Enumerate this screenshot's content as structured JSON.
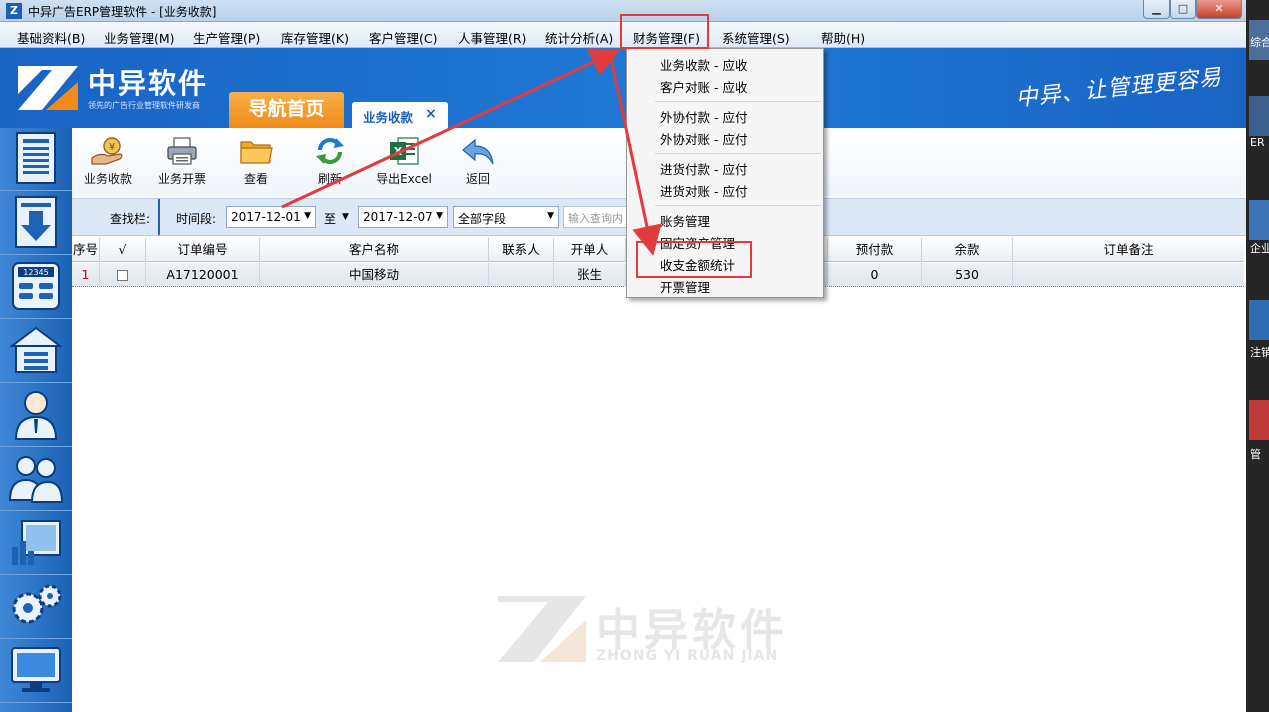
{
  "window": {
    "app_icon": "Z",
    "title": "中异广告ERP管理软件 - [业务收款]",
    "minimize_icon": "minimize-icon",
    "maximize_icon": "maximize-icon",
    "close_icon": "close-icon"
  },
  "menubar": {
    "items": [
      "基础资料(B)",
      "业务管理(M)",
      "生产管理(P)",
      "库存管理(K)",
      "客户管理(C)",
      "人事管理(R)",
      "统计分析(A)",
      "财务管理(F)",
      "系统管理(S)",
      "帮助(H)"
    ]
  },
  "banner": {
    "logo_text": "中异软件",
    "logo_sub": "领先的广告行业管理软件研发商",
    "nav_home": "导航首页",
    "active_tab": "业务收款",
    "tab_close": "×",
    "slogan": "中异、让管理更容易"
  },
  "toolbar": {
    "buttons": [
      {
        "label": "业务收款",
        "icon": "money-hand-icon"
      },
      {
        "label": "业务开票",
        "icon": "printer-icon"
      },
      {
        "label": "查看",
        "icon": "folder-icon"
      },
      {
        "label": "刷新",
        "icon": "refresh-icon"
      },
      {
        "label": "导出Excel",
        "icon": "excel-icon"
      },
      {
        "label": "返回",
        "icon": "back-arrow-icon"
      }
    ]
  },
  "search": {
    "label": "查找栏:",
    "period_label": "时间段:",
    "date_from": "2017-12-01",
    "to_label": "至",
    "date_to": "2017-12-07",
    "field_select": "全部字段",
    "query_placeholder": "输入查询内"
  },
  "table": {
    "columns": [
      "序号",
      "√",
      "订单编号",
      "客户名称",
      "联系人",
      "开单人",
      "预付款",
      "余款",
      "订单备注"
    ],
    "rows": [
      {
        "index": "1",
        "order_no": "A17120001",
        "customer": "中国移动",
        "contact": "",
        "creator": "张生",
        "prepaid": "0",
        "balance": "530",
        "note": ""
      }
    ]
  },
  "finance_menu": {
    "items": [
      "业务收款 - 应收",
      "客户对账 - 应收",
      "外协付款 - 应付",
      "外协对账 - 应付",
      "进货付款 - 应付",
      "进货对账 - 应付",
      "账务管理",
      "固定资产管理",
      "收支金额统计",
      "开票管理"
    ]
  },
  "watermark": {
    "cn": "中异软件",
    "en": "ZHONG YI RUAN JIAN"
  },
  "desktop_edge": {
    "labels": [
      "综合",
      "ER",
      "企业",
      "注销",
      "管"
    ]
  },
  "colors": {
    "banner_blue": "#1a63c4",
    "nav_orange": "#f08a18",
    "highlight_red": "#e23b3b",
    "leftbar_blue": "#1d62b5"
  }
}
